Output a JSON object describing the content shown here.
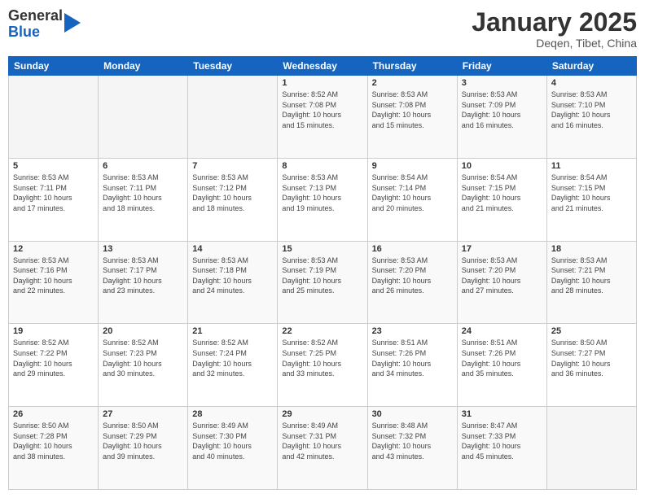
{
  "logo": {
    "general": "General",
    "blue": "Blue"
  },
  "header": {
    "title": "January 2025",
    "subtitle": "Deqen, Tibet, China"
  },
  "weekdays": [
    "Sunday",
    "Monday",
    "Tuesday",
    "Wednesday",
    "Thursday",
    "Friday",
    "Saturday"
  ],
  "weeks": [
    [
      {
        "day": "",
        "info": ""
      },
      {
        "day": "",
        "info": ""
      },
      {
        "day": "",
        "info": ""
      },
      {
        "day": "1",
        "info": "Sunrise: 8:52 AM\nSunset: 7:08 PM\nDaylight: 10 hours\nand 15 minutes."
      },
      {
        "day": "2",
        "info": "Sunrise: 8:53 AM\nSunset: 7:08 PM\nDaylight: 10 hours\nand 15 minutes."
      },
      {
        "day": "3",
        "info": "Sunrise: 8:53 AM\nSunset: 7:09 PM\nDaylight: 10 hours\nand 16 minutes."
      },
      {
        "day": "4",
        "info": "Sunrise: 8:53 AM\nSunset: 7:10 PM\nDaylight: 10 hours\nand 16 minutes."
      }
    ],
    [
      {
        "day": "5",
        "info": "Sunrise: 8:53 AM\nSunset: 7:11 PM\nDaylight: 10 hours\nand 17 minutes."
      },
      {
        "day": "6",
        "info": "Sunrise: 8:53 AM\nSunset: 7:11 PM\nDaylight: 10 hours\nand 18 minutes."
      },
      {
        "day": "7",
        "info": "Sunrise: 8:53 AM\nSunset: 7:12 PM\nDaylight: 10 hours\nand 18 minutes."
      },
      {
        "day": "8",
        "info": "Sunrise: 8:53 AM\nSunset: 7:13 PM\nDaylight: 10 hours\nand 19 minutes."
      },
      {
        "day": "9",
        "info": "Sunrise: 8:54 AM\nSunset: 7:14 PM\nDaylight: 10 hours\nand 20 minutes."
      },
      {
        "day": "10",
        "info": "Sunrise: 8:54 AM\nSunset: 7:15 PM\nDaylight: 10 hours\nand 21 minutes."
      },
      {
        "day": "11",
        "info": "Sunrise: 8:54 AM\nSunset: 7:15 PM\nDaylight: 10 hours\nand 21 minutes."
      }
    ],
    [
      {
        "day": "12",
        "info": "Sunrise: 8:53 AM\nSunset: 7:16 PM\nDaylight: 10 hours\nand 22 minutes."
      },
      {
        "day": "13",
        "info": "Sunrise: 8:53 AM\nSunset: 7:17 PM\nDaylight: 10 hours\nand 23 minutes."
      },
      {
        "day": "14",
        "info": "Sunrise: 8:53 AM\nSunset: 7:18 PM\nDaylight: 10 hours\nand 24 minutes."
      },
      {
        "day": "15",
        "info": "Sunrise: 8:53 AM\nSunset: 7:19 PM\nDaylight: 10 hours\nand 25 minutes."
      },
      {
        "day": "16",
        "info": "Sunrise: 8:53 AM\nSunset: 7:20 PM\nDaylight: 10 hours\nand 26 minutes."
      },
      {
        "day": "17",
        "info": "Sunrise: 8:53 AM\nSunset: 7:20 PM\nDaylight: 10 hours\nand 27 minutes."
      },
      {
        "day": "18",
        "info": "Sunrise: 8:53 AM\nSunset: 7:21 PM\nDaylight: 10 hours\nand 28 minutes."
      }
    ],
    [
      {
        "day": "19",
        "info": "Sunrise: 8:52 AM\nSunset: 7:22 PM\nDaylight: 10 hours\nand 29 minutes."
      },
      {
        "day": "20",
        "info": "Sunrise: 8:52 AM\nSunset: 7:23 PM\nDaylight: 10 hours\nand 30 minutes."
      },
      {
        "day": "21",
        "info": "Sunrise: 8:52 AM\nSunset: 7:24 PM\nDaylight: 10 hours\nand 32 minutes."
      },
      {
        "day": "22",
        "info": "Sunrise: 8:52 AM\nSunset: 7:25 PM\nDaylight: 10 hours\nand 33 minutes."
      },
      {
        "day": "23",
        "info": "Sunrise: 8:51 AM\nSunset: 7:26 PM\nDaylight: 10 hours\nand 34 minutes."
      },
      {
        "day": "24",
        "info": "Sunrise: 8:51 AM\nSunset: 7:26 PM\nDaylight: 10 hours\nand 35 minutes."
      },
      {
        "day": "25",
        "info": "Sunrise: 8:50 AM\nSunset: 7:27 PM\nDaylight: 10 hours\nand 36 minutes."
      }
    ],
    [
      {
        "day": "26",
        "info": "Sunrise: 8:50 AM\nSunset: 7:28 PM\nDaylight: 10 hours\nand 38 minutes."
      },
      {
        "day": "27",
        "info": "Sunrise: 8:50 AM\nSunset: 7:29 PM\nDaylight: 10 hours\nand 39 minutes."
      },
      {
        "day": "28",
        "info": "Sunrise: 8:49 AM\nSunset: 7:30 PM\nDaylight: 10 hours\nand 40 minutes."
      },
      {
        "day": "29",
        "info": "Sunrise: 8:49 AM\nSunset: 7:31 PM\nDaylight: 10 hours\nand 42 minutes."
      },
      {
        "day": "30",
        "info": "Sunrise: 8:48 AM\nSunset: 7:32 PM\nDaylight: 10 hours\nand 43 minutes."
      },
      {
        "day": "31",
        "info": "Sunrise: 8:47 AM\nSunset: 7:33 PM\nDaylight: 10 hours\nand 45 minutes."
      },
      {
        "day": "",
        "info": ""
      }
    ]
  ]
}
